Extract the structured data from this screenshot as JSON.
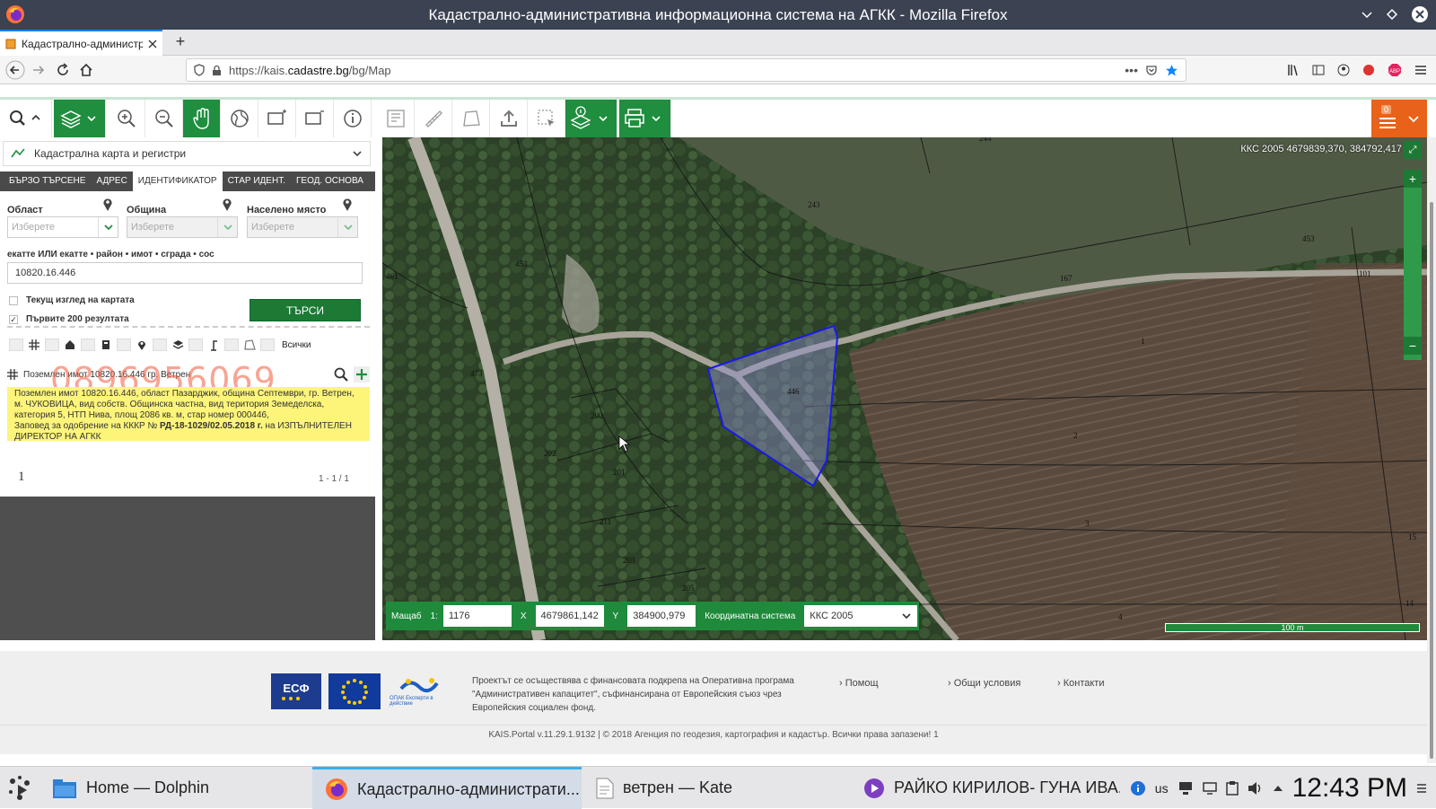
{
  "window": {
    "title": "Кадастрално-административна информационна система на АГКК - Mozilla Firefox"
  },
  "browser": {
    "tab_title": "Кадастрално-администр",
    "url_prefix": "https://kais.",
    "url_domain": "cadastre.bg",
    "url_path": "/bg/Map"
  },
  "toolbar": {
    "notif_count": "0"
  },
  "panel": {
    "dataset": "Кадастрална карта и регистри",
    "tabs": [
      "БЪРЗО ТЪРСЕНЕ",
      "АДРЕС",
      "ИДЕНТИФИКАТОР",
      "СТАР ИДЕНТ.",
      "ГЕОД. ОСНОВА"
    ],
    "active_tab": "ИДЕНТИФИКАТОР",
    "region_label": "Област",
    "municipality_label": "Община",
    "settlement_label": "Населено място",
    "select_placeholder": "Изберете",
    "identifier_label": "екатте ИЛИ екатте • район • имот • сграда • сос",
    "identifier_value": "10820.16.446",
    "current_view_label": "Текущ изглед на картата",
    "first200_label": "Първите 200 резултата",
    "first200_checked": "✓",
    "search_button": "ТЪРСИ",
    "filter_all": "Всички",
    "result_title": "Поземлен имот 10820.16.446 гр. Ветрен",
    "watermark_phone": "0896956069",
    "result_text": "Поземлен имот 10820.16.446, област Пазарджик, община Септември, гр. Ветрен, м. ЧУКОВИЦА, вид собств. Общинска частна, вид територия Земеделска, категория 5, НТП Нива, площ 2086 кв. м, стар номер 000446,",
    "result_text2_pre": "Заповед за одобрение на КККР №",
    "result_order": "РД-18-1029/02.05.2018 г.",
    "result_text2_post": "на ИЗПЪЛНИТЕЛЕН ДИРЕКТОР НА АГКК",
    "page": "1",
    "page_count": "1 - 1 / 1"
  },
  "map": {
    "coord_readout": "ККС 2005 4679839,370, 384792,417",
    "scale_label": "Мащаб",
    "scale_prefix": "1:",
    "scale_value": "1176",
    "x_label": "X",
    "x_value": "4679861,142",
    "y_label": "Y",
    "y_value": "384900,979",
    "crs_label": "Координатна система",
    "crs_value": "ККС 2005",
    "scalebar_label": "100 m",
    "parcel_numbers": [
      "244",
      "243",
      "461",
      "453",
      "473",
      "167",
      "101",
      "446",
      "1",
      "200",
      "202",
      "201",
      "2",
      "211",
      "3",
      "203",
      "205",
      "15",
      "14",
      "4",
      "453"
    ]
  },
  "footer": {
    "text": "Проектът се осъществява с финансовата подкрепа на Оперативна програма \"Административен капацитет\", съфинансирана от Европейския съюз чрез Европейския социален фонд.",
    "links": [
      "Помощ",
      "Общи условия",
      "Контакти"
    ],
    "version": "KAIS.Portal v.11.29.1.9132  |  © 2018 Агенция по геодезия, картография и кадастър. Всички права запазени! 1",
    "esf_logo_text": "ЕСФ",
    "opak_text": "ОПАК Експерти в действие"
  },
  "taskbar": {
    "tasks": [
      "Home — Dolphin",
      "Кадастрално-администрати...",
      "ветрен — Kate",
      "РАЙКО КИРИЛОВ- ГУНА ИВА..."
    ],
    "kb_layout": "us",
    "clock": "12:43 PM"
  },
  "colors": {
    "accent_green": "#1f8e3e",
    "parcel_outline": "#1a1ae6",
    "highlight_yellow": "#fdf47a"
  }
}
